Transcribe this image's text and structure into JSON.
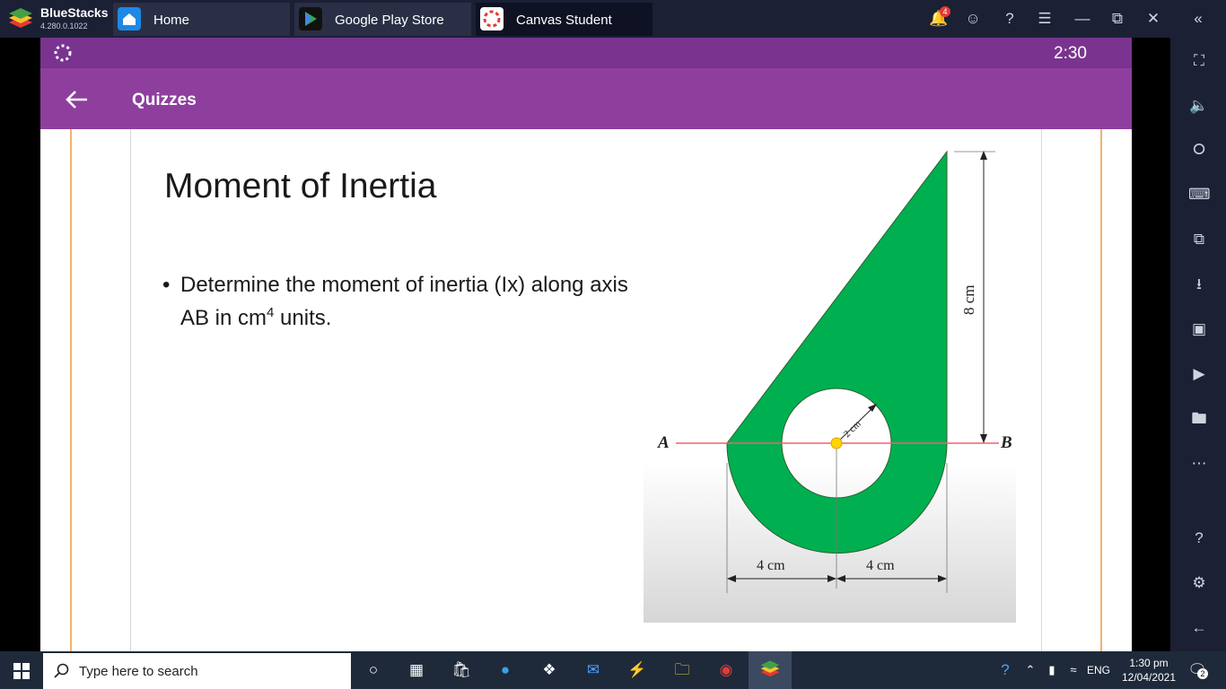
{
  "emulator": {
    "brand": "BlueStacks",
    "version": "4.280.0.1022",
    "notification_count": "4"
  },
  "tabs": [
    {
      "label": "Home"
    },
    {
      "label": "Google Play Store"
    },
    {
      "label": "Canvas Student"
    }
  ],
  "android": {
    "clock": "2:30",
    "app_title": "Quizzes"
  },
  "slide": {
    "title": "Moment of Inertia",
    "bullet_prefix": "Determine the moment of inertia (Ix) along axis AB in cm",
    "bullet_superscript": "4",
    "bullet_suffix": " units."
  },
  "diagram": {
    "point_a": "A",
    "point_b": "B",
    "height_label": "8 cm",
    "radius_label": "2 cm",
    "left_width_label": "4 cm",
    "right_width_label": "4 cm",
    "shape_color": "#00b050"
  },
  "taskbar": {
    "search_placeholder": "Type here to search",
    "language": "ENG",
    "time": "1:30 pm",
    "date": "12/04/2021",
    "notifications": "2"
  },
  "colors": {
    "titlebar": "#1c2035",
    "status_bar": "#7a3490",
    "app_bar": "#8e3f9e"
  }
}
